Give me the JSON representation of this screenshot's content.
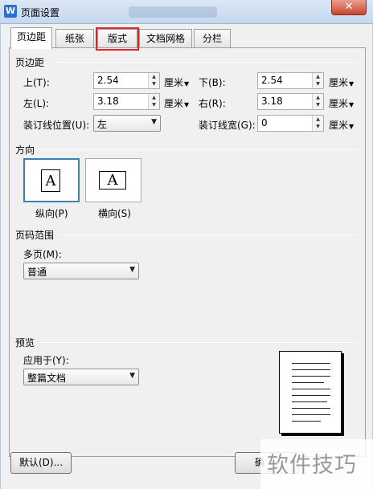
{
  "window": {
    "title": "页面设置",
    "app_icon": "W",
    "close": "✕"
  },
  "tabs": [
    "页边距",
    "纸张",
    "版式",
    "文档网格",
    "分栏"
  ],
  "margins": {
    "group_title": "页边距",
    "top_label": "上(T):",
    "top_value": "2.54",
    "top_unit": "厘米",
    "bottom_label": "下(B):",
    "bottom_value": "2.54",
    "bottom_unit": "厘米",
    "left_label": "左(L):",
    "left_value": "3.18",
    "left_unit": "厘米",
    "right_label": "右(R):",
    "right_value": "3.18",
    "right_unit": "厘米",
    "gutter_pos_label": "装订线位置(U):",
    "gutter_pos_value": "左",
    "gutter_width_label": "装订线宽(G):",
    "gutter_width_value": "0",
    "gutter_width_unit": "厘米"
  },
  "orientation": {
    "group_title": "方向",
    "portrait_label": "纵向(P)",
    "landscape_label": "横向(S)",
    "icon_letter": "A"
  },
  "pages": {
    "group_title": "页码范围",
    "multiple_label": "多页(M):",
    "multiple_value": "普通"
  },
  "preview": {
    "group_title": "预览",
    "apply_label": "应用于(Y):",
    "apply_value": "整篇文档"
  },
  "buttons": {
    "default": "默认(D)...",
    "ok_partial": "确"
  },
  "watermark": "软件技巧"
}
